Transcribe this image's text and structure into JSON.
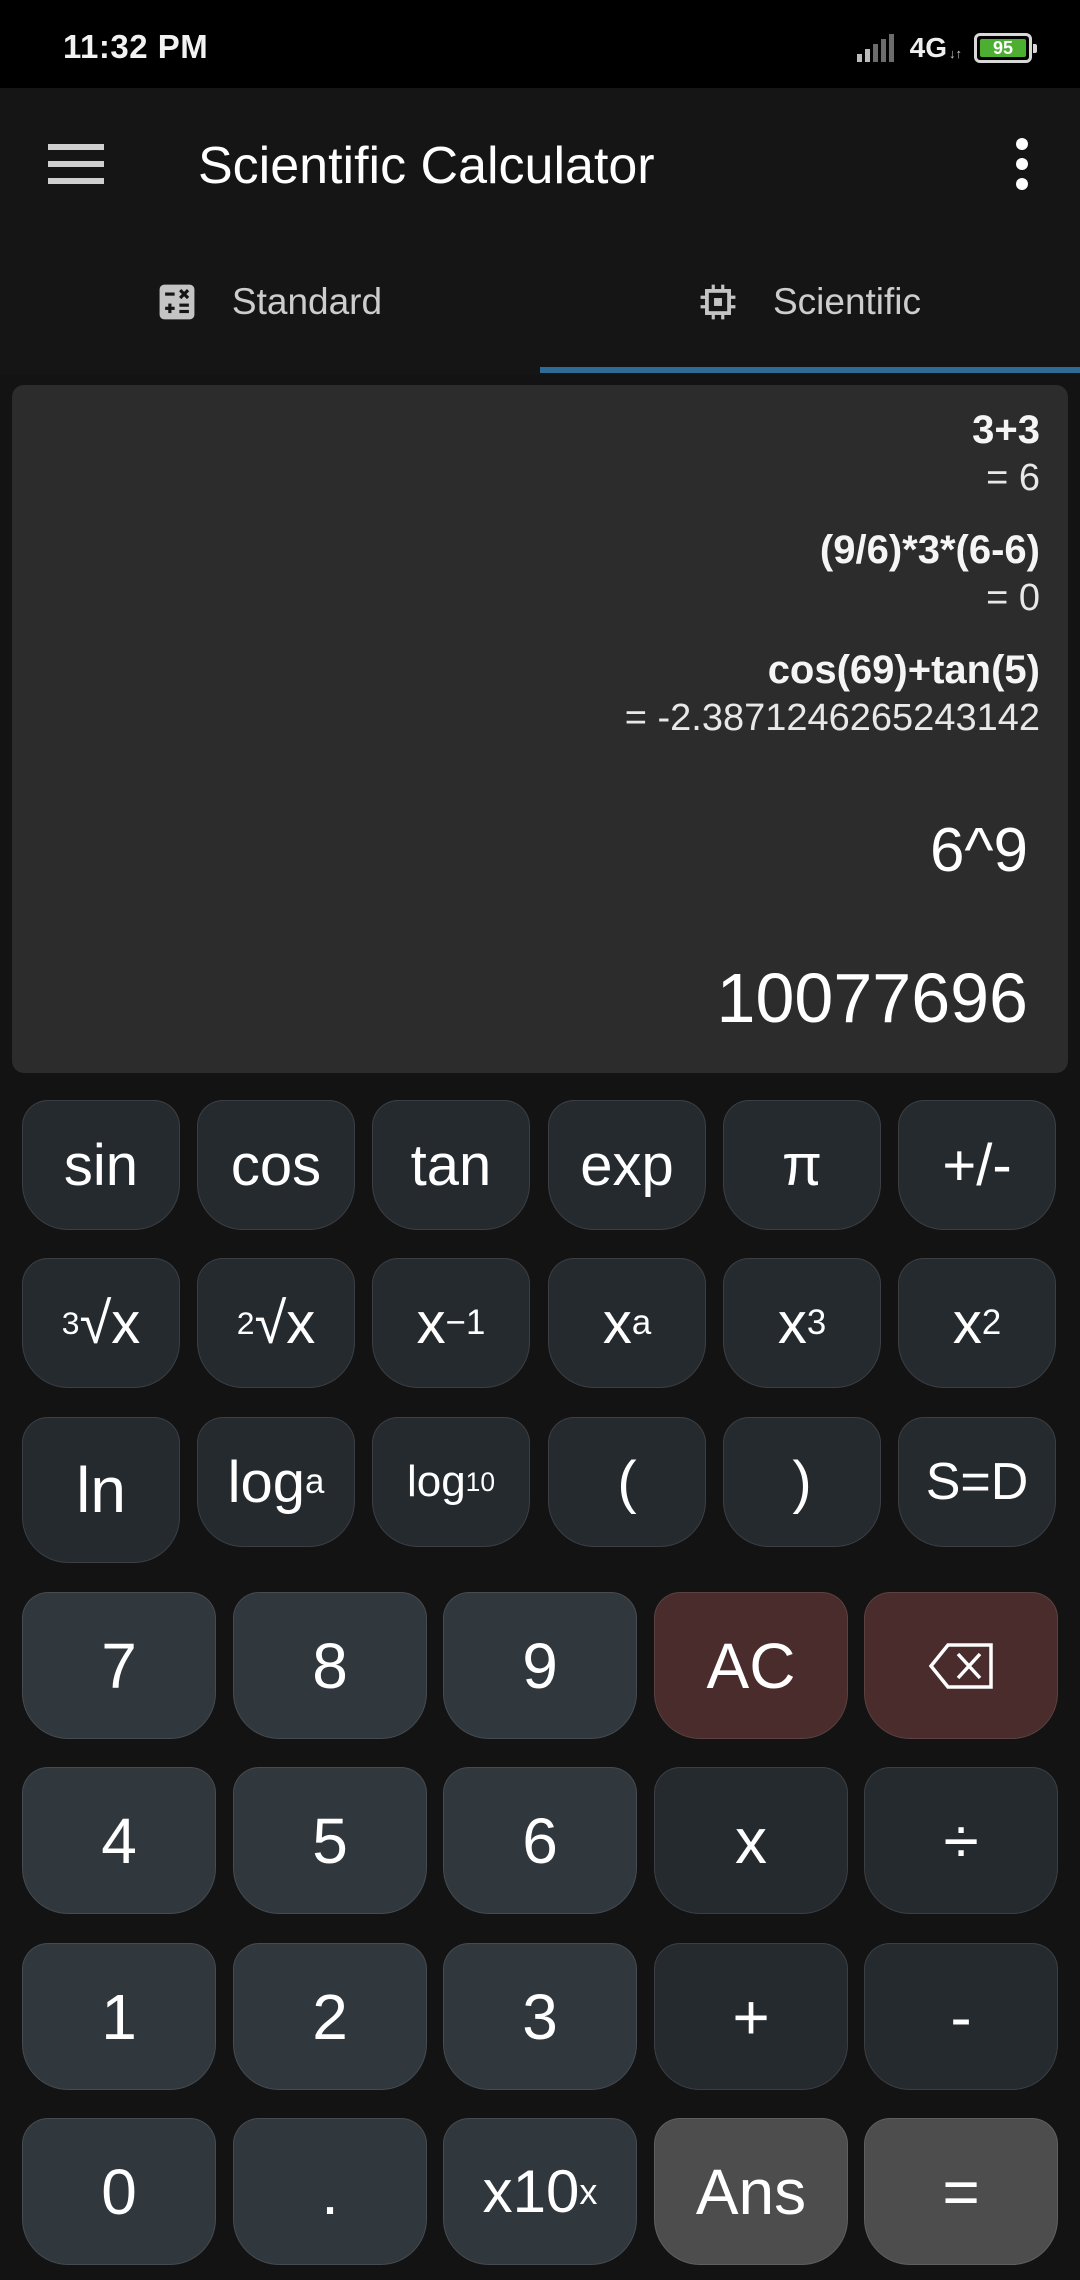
{
  "status_bar": {
    "time": "11:32 PM",
    "network": "4G",
    "network_activity": "↓↑",
    "battery": "95"
  },
  "app_bar": {
    "title": "Scientific Calculator",
    "menu_icon": "hamburger-menu-icon",
    "more_icon": "more-vertical-icon"
  },
  "tabs": [
    {
      "label": "Standard",
      "icon": "calculator-icon",
      "active": false
    },
    {
      "label": "Scientific",
      "icon": "chip-icon",
      "active": true
    }
  ],
  "display": {
    "history": [
      {
        "expression": "3+3",
        "result": "= 6"
      },
      {
        "expression": "(9/6)*3*(6-6)",
        "result": "= 0"
      },
      {
        "expression": "cos(69)+tan(5)",
        "result": "= -2.3871246265243142"
      }
    ],
    "current_expression": "6^9",
    "current_result": "10077696"
  },
  "keys": {
    "sin": "sin",
    "cos": "cos",
    "tan": "tan",
    "exp": "exp",
    "pi": "π",
    "negate": "+/-",
    "cube_root_pre": "3",
    "square_root_pre": "2",
    "root_body": "√x",
    "x_base": "x",
    "inverse_sup": "−1",
    "power_sup": "a",
    "cube_sup": "3",
    "square_sup": "2",
    "ln": "ln",
    "log_base": "log",
    "log_a_sub": "a",
    "log_10_sub": "10",
    "open_paren": "(",
    "close_paren": ")",
    "s_to_d": "S=D",
    "d7": "7",
    "d8": "8",
    "d9": "9",
    "clear": "AC",
    "backspace_icon": "backspace-icon",
    "d4": "4",
    "d5": "5",
    "d6": "6",
    "multiply": "x",
    "divide": "÷",
    "d1": "1",
    "d2": "2",
    "d3": "3",
    "add": "+",
    "subtract": "-",
    "d0": "0",
    "decimal": ".",
    "sci_notation_base": "x10",
    "sci_notation_sup": "x",
    "answer": "Ans",
    "equals": "="
  },
  "colors": {
    "tab_indicator": "#2e6b96",
    "digit_key": "#30373d",
    "operator_key": "#252a2f",
    "clear_key": "#492c2b",
    "answer_key": "#4d4d4d",
    "display_bg": "#2c2c2c",
    "battery": "#4caf32"
  }
}
